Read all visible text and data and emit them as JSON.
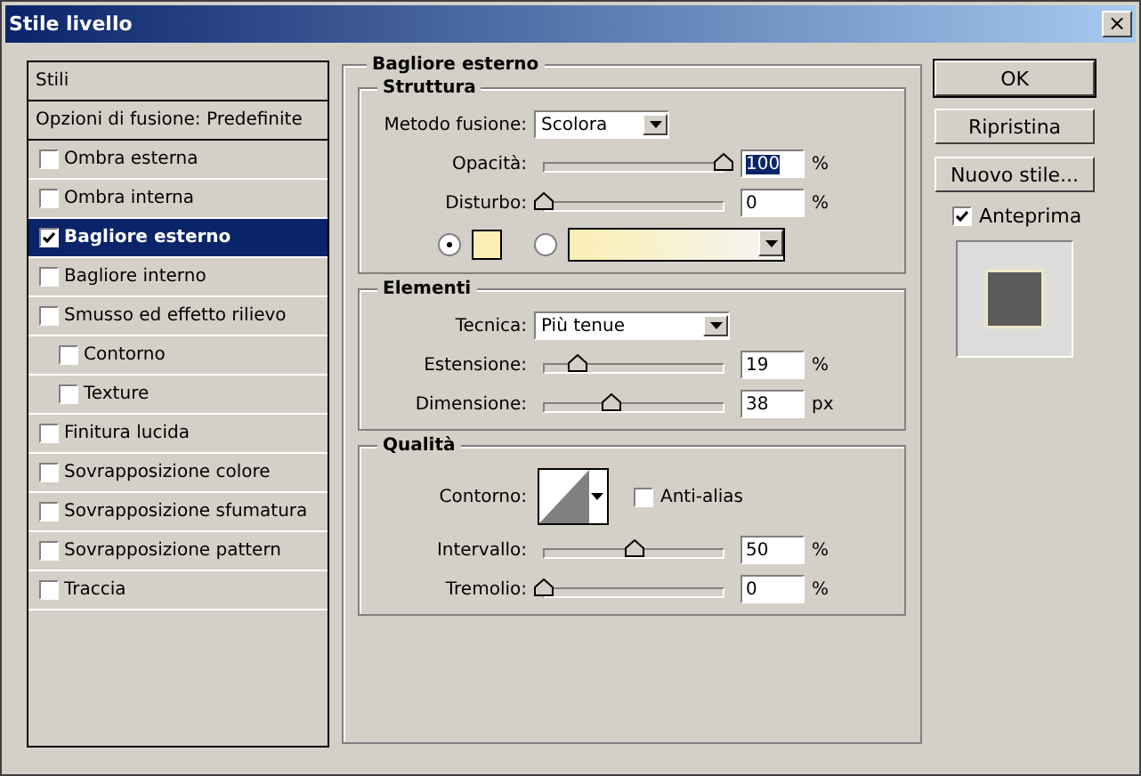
{
  "window": {
    "title": "Stile livello",
    "close": "×"
  },
  "sidebar": {
    "items": [
      {
        "kind": "header",
        "label": "Stili",
        "selected": false
      },
      {
        "kind": "header",
        "label": "Opzioni di fusione: Predefinite",
        "selected": false
      },
      {
        "kind": "check",
        "label": "Ombra esterna",
        "checked": false,
        "selected": false
      },
      {
        "kind": "check",
        "label": "Ombra interna",
        "checked": false,
        "selected": false
      },
      {
        "kind": "check",
        "label": "Bagliore esterno",
        "checked": true,
        "selected": true
      },
      {
        "kind": "check",
        "label": "Bagliore interno",
        "checked": false,
        "selected": false
      },
      {
        "kind": "check",
        "label": "Smusso ed effetto rilievo",
        "checked": false,
        "selected": false,
        "children": [
          {
            "kind": "check",
            "label": "Contorno",
            "checked": false,
            "selected": false
          },
          {
            "kind": "check",
            "label": "Texture",
            "checked": false,
            "selected": false
          }
        ]
      },
      {
        "kind": "check",
        "label": "Finitura lucida",
        "checked": false,
        "selected": false
      },
      {
        "kind": "check",
        "label": "Sovrapposizione colore",
        "checked": false,
        "selected": false
      },
      {
        "kind": "check",
        "label": "Sovrapposizione sfumatura",
        "checked": false,
        "selected": false
      },
      {
        "kind": "check",
        "label": "Sovrapposizione pattern",
        "checked": false,
        "selected": false
      },
      {
        "kind": "check",
        "label": "Traccia",
        "checked": false,
        "selected": false
      }
    ]
  },
  "panel": {
    "title": "Bagliore esterno",
    "groups": [
      {
        "title": "Struttura",
        "rows": [
          {
            "kind": "select",
            "label": "Metodo fusione:",
            "value": "Scolora"
          },
          {
            "kind": "slider",
            "label": "Opacità:",
            "level": 1,
            "value": "100",
            "unit": "%",
            "highlighted": true
          },
          {
            "kind": "slider",
            "label": "Disturbo:",
            "level": 0,
            "value": "0",
            "unit": "%",
            "highlighted": false
          },
          {
            "kind": "fill",
            "color": "#fbefb4",
            "options": [
              {
                "kind": "color",
                "selected": true
              },
              {
                "kind": "gradient",
                "selected": false
              }
            ]
          }
        ]
      },
      {
        "title": "Elementi",
        "rows": [
          {
            "kind": "select",
            "label": "Tecnica:",
            "value": "Più tenue"
          },
          {
            "kind": "slider",
            "label": "Estensione:",
            "level": 0.19,
            "value": "19",
            "unit": "%",
            "highlighted": false
          },
          {
            "kind": "slider",
            "label": "Dimensione:",
            "level": 0.38,
            "value": "38",
            "unit": "px",
            "highlighted": false
          }
        ]
      },
      {
        "title": "Qualità",
        "rows": [
          {
            "kind": "contour",
            "label": "Contorno:",
            "checkbox": {
              "label": "Anti-alias",
              "checked": false
            }
          },
          {
            "kind": "slider",
            "label": "Intervallo:",
            "level": 0.5,
            "value": "50",
            "unit": "%",
            "highlighted": false
          },
          {
            "kind": "slider",
            "label": "Tremolio:",
            "level": 0,
            "value": "0",
            "unit": "%",
            "highlighted": false
          }
        ]
      }
    ]
  },
  "buttons": [
    {
      "label": "OK",
      "default": true
    },
    {
      "label": "Ripristina",
      "default": false
    },
    {
      "label": "Nuovo stile...",
      "default": false
    }
  ],
  "preview": {
    "label": "Anteprima",
    "checked": true
  }
}
